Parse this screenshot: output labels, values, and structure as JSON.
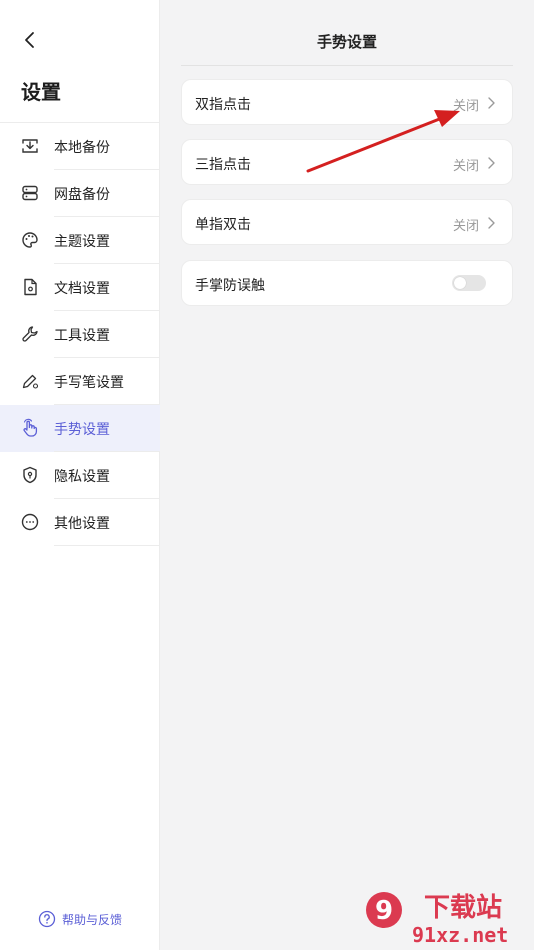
{
  "sidebar": {
    "title": "设置",
    "items": [
      {
        "label": "本地备份",
        "icon": "local-backup-icon"
      },
      {
        "label": "网盘备份",
        "icon": "cloud-backup-icon"
      },
      {
        "label": "主题设置",
        "icon": "palette-icon"
      },
      {
        "label": "文档设置",
        "icon": "document-icon"
      },
      {
        "label": "工具设置",
        "icon": "wrench-icon"
      },
      {
        "label": "手写笔设置",
        "icon": "pen-icon"
      },
      {
        "label": "手势设置",
        "icon": "hand-gesture-icon",
        "active": true
      },
      {
        "label": "隐私设置",
        "icon": "shield-icon"
      },
      {
        "label": "其他设置",
        "icon": "more-icon"
      }
    ],
    "help_label": "帮助与反馈"
  },
  "main": {
    "title": "手势设置",
    "rows": [
      {
        "label": "双指点击",
        "value": "关闭"
      },
      {
        "label": "三指点击",
        "value": "关闭"
      },
      {
        "label": "单指双击",
        "value": "关闭"
      },
      {
        "label": "手掌防误触",
        "toggle": false
      }
    ]
  },
  "watermark": {
    "line1": "下载站",
    "line2": "91xz.net",
    "logo_text": "9"
  },
  "colors": {
    "accent": "#5b5fd6",
    "active_bg": "#eef0fb",
    "page_bg": "#f3f3f4",
    "annotation_arrow": "#d42020",
    "watermark": "#d8213a"
  }
}
